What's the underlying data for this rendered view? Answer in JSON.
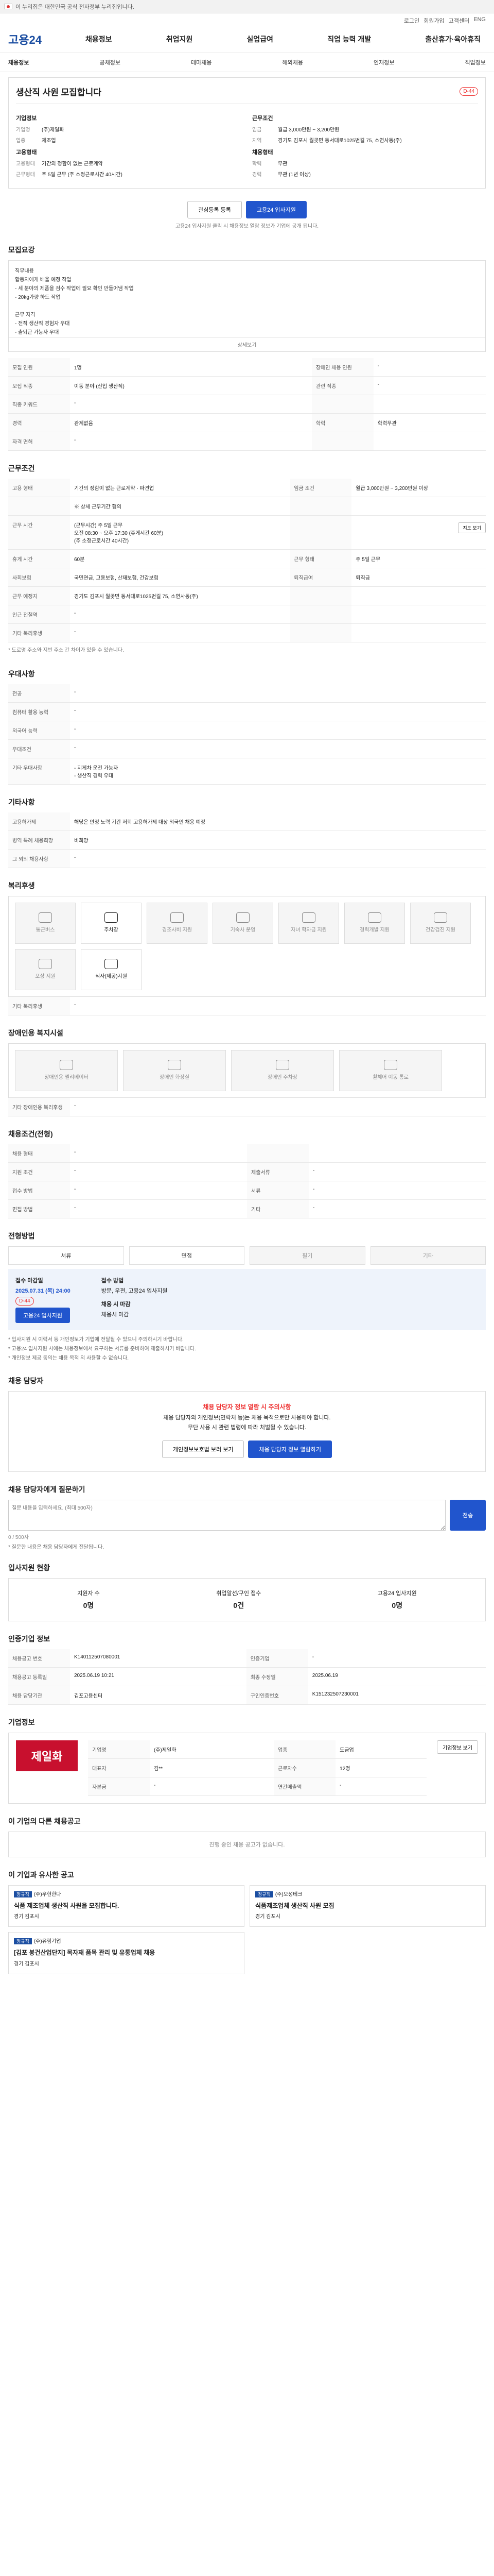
{
  "topbar": {
    "text": "이 누리집은 대한민국 공식 전자정부 누리집입니다."
  },
  "util": [
    "로그인",
    "회원가입",
    "고객센터",
    "ENG"
  ],
  "header": {
    "logo": "고용24",
    "gnb": [
      "채용정보",
      "취업지원",
      "실업급여",
      "직업 능력 개발",
      "출산휴가·육아휴직"
    ]
  },
  "subnav": [
    "채용정보",
    "공채정보",
    "테마채용",
    "해외채용",
    "인재정보",
    "직업정보"
  ],
  "job": {
    "title": "생산직 사원 모집합니다",
    "dday": "D-44",
    "company_h": "기업정보",
    "company": [
      [
        "기업명",
        "(주)제일화"
      ],
      [
        "업종",
        "제조업"
      ]
    ],
    "cond_h": "근무조건",
    "cond": [
      [
        "임금",
        "월급 3,000만원 ~ 3,200만원"
      ],
      [
        "지역",
        "경기도 김포시 월곶면 동서대로1025번길 75, 소연사동(주)"
      ]
    ],
    "hire_h": "고용형태",
    "hire": [
      [
        "고용형태",
        "기간의 정함이 없는 근로계약"
      ],
      [
        "근무형태",
        "주 5일 근무 (주 소정근로시간 40시간)"
      ]
    ],
    "edu_h": "채용형태",
    "edu": [
      [
        "학력",
        "무관"
      ],
      [
        "경력",
        "무관 (1년 이상)"
      ]
    ],
    "btn_interest": "관심등록 등록",
    "btn_apply": "고용24 입사지원",
    "note": "고용24 입사지원 클릭 시 채용정보 열람 정보가 기업에 공개 됩니다."
  },
  "recruit": {
    "h": "모집요강",
    "desc": "직무내용\n합동자에게 배울 예정 작업\n- 세 분야의 제품을 검수 작업에 필요 확인 만들어냄 작업\n- 20kg가량 하드 작업\n\n근무 자격\n- 전직 생산직 경험자 우대\n- 출퇴근 가능자 우대\n- 성실한 분\n- 장기 근속 가능자\n- 신입 및 경력 모두 지원 가능",
    "more": "상세보기",
    "rows": [
      [
        "모집 인원",
        "1명",
        "장애인 채용 인원",
        "-"
      ],
      [
        "모집 직종",
        "이동 분야 (신입 생산직)",
        "관련 직종",
        "-"
      ],
      [
        "직종 키워드",
        "-",
        "",
        ""
      ],
      [
        "경력",
        "관계없음",
        "학력",
        "학력무관"
      ],
      [
        "자격 면허",
        "-",
        "",
        ""
      ]
    ]
  },
  "work": {
    "h": "근무조건",
    "rows": [
      [
        "고용 형태",
        "기간의 정함이 없는 근로계약 · 파견업",
        "임금 조건",
        "월급 3,000만원 ~ 3,200만원 이상"
      ],
      [
        "",
        "※ 상세 근무기간 협의",
        "",
        ""
      ],
      [
        "근무 시간",
        "(근무시간) 주 5일 근무\n오전 08:30 ~ 오후 17:30 (휴게시간 60분)\n(주 소정근로시간 40시간)",
        "",
        ""
      ],
      [
        "휴게 시간",
        "60분",
        "근무 형태",
        "주 5일 근무"
      ],
      [
        "사회보험",
        "국민연금, 고용보험, 산재보험, 건강보험",
        "퇴직급여",
        "퇴직금"
      ],
      [
        "근무 예정지",
        "경기도 김포시 월곶면 동서대로1025번길 75, 소연사동(주)",
        "",
        ""
      ],
      [
        "인근 전철역",
        "-",
        "",
        ""
      ],
      [
        "기타 복리후생",
        "-",
        "",
        ""
      ]
    ],
    "map_btn": "지도 보기",
    "foot": "* 도로명 주소와 지번 주소 간 차이가 있을 수 있습니다."
  },
  "pref": {
    "h": "우대사항",
    "rows": [
      [
        "전공",
        "-"
      ],
      [
        "컴퓨터 활용 능력",
        "-"
      ],
      [
        "외국어 능력",
        "-"
      ],
      [
        "우대조건",
        "-"
      ],
      [
        "기타 우대사항",
        "- 지게차 운전 가능자\n- 생산직 경력 우대"
      ]
    ]
  },
  "etc": {
    "h": "기타사항",
    "rows": [
      [
        "고용허가제",
        "해당은 안정 노력 기간 저희 고용허가제 대상 외국인 채용 예정"
      ],
      [
        "병역 특례 채용희망",
        "비희망"
      ],
      [
        "그 외의 채용사항",
        "-"
      ]
    ]
  },
  "welfare": {
    "h": "복리후생",
    "items": [
      {
        "label": "통근버스",
        "on": false
      },
      {
        "label": "주차장",
        "on": true
      },
      {
        "label": "경조사비 지원",
        "on": false
      },
      {
        "label": "기숙사 운영",
        "on": false
      },
      {
        "label": "자녀 학자금 지원",
        "on": false
      },
      {
        "label": "경력개발 지원",
        "on": false
      },
      {
        "label": "건강검진 지원",
        "on": false
      },
      {
        "label": "포상 지원",
        "on": false
      },
      {
        "label": "식사(제공)지원",
        "on": true
      }
    ],
    "other_label": "기타 복리후생",
    "other_value": "-"
  },
  "disab": {
    "h": "장애인용 복지시설",
    "items": [
      "장애인용 엘리베이터",
      "장애인 화장실",
      "장애인 주차장",
      "휠체어 이동 통로"
    ],
    "other_label": "기타 장애인용 복리후생",
    "other_value": "-"
  },
  "req": {
    "h": "채용조건(전형)",
    "rows": [
      [
        "채용 형태",
        "-",
        "",
        ""
      ],
      [
        "지원 조건",
        "-",
        "제출서류",
        "-"
      ],
      [
        "접수 방법",
        "-",
        "서류",
        "-"
      ],
      [
        "면접 방법",
        "-",
        "기타",
        "-"
      ]
    ]
  },
  "proc": {
    "h": "전형방법",
    "steps": [
      [
        "서류",
        false
      ],
      [
        "면접",
        false
      ],
      [
        "필기",
        true
      ],
      [
        "기타",
        true
      ]
    ]
  },
  "apply": {
    "h1": "접수 마감일",
    "d1": "2025.07.31 (목) 24:00",
    "dday": "D-44",
    "btn": "고용24 입사지원",
    "h2": "접수 방법",
    "d2": "방문, 우편, 고용24 입사지원",
    "h3": "채용 시 마감",
    "d3": "채용시 마감"
  },
  "caution": [
    "* 입사지원 시 이력서 등 개인정보가 기업에 전달될 수 있으니 주의하시기 바랍니다.",
    "* 고용24 입사지원 시에는 채용정보에서 요구하는 서류를 준비하여 제출하시기 바랍니다.",
    "* 개인정보 제공 동의는 채용 목적 외 사용할 수 없습니다."
  ],
  "contact": {
    "h": "채용 담당자",
    "warn_t": "채용 담당자 정보 열람 시 주의사항",
    "warn_1": "채용 담당자의 개인정보(연락처 등)는 채용 목적으로만 사용해야 합니다.",
    "warn_2": "무단 사용 시 관련 법령에 따라 처벌될 수 있습니다.",
    "btn1": "개인정보보호법 보러 보기",
    "btn2": "채용 담당자 정보 열람하기"
  },
  "qna": {
    "h": "채용 담당자에게 질문하기",
    "placeholder": "질문 내용을 입력하세요. (최대 500자)",
    "count": "0 / 500자",
    "btn": "전송",
    "note": "* 질문한 내용은 채용 담당자에게 전달됩니다."
  },
  "stats": {
    "h": "입사지원 현황",
    "items": [
      [
        "지원자 수",
        "0명"
      ],
      [
        "취업알선/구인 접수",
        "0건"
      ],
      [
        "고용24 입사지원",
        "0명"
      ]
    ],
    "more": "더보기"
  },
  "info": {
    "h": "인증기업 정보",
    "rows": [
      [
        "채용공고 번호",
        "K140112507080001",
        "인증기업",
        "-"
      ],
      [
        "채용공고 등록일",
        "2025.06.19 10:21",
        "최종 수정일",
        "2025.06.19"
      ],
      [
        "채용 담당기관",
        "김포고용센터",
        "구인인증번호",
        "K151232507230001"
      ]
    ]
  },
  "company": {
    "h": "기업정보",
    "logo": "제일화",
    "rows": [
      [
        "기업명",
        "(주)제일화",
        "업종",
        "도금업"
      ],
      [
        "대표자",
        "김**",
        "근로자수",
        "12명"
      ],
      [
        "자본금",
        "-",
        "연간매출액",
        "-"
      ]
    ],
    "btn": "기업정보 보기"
  },
  "related": {
    "h": "이 기업의 다른 채용공고",
    "empty": "진행 중인 채용 공고가 없습니다."
  },
  "recommend": {
    "h": "이 기업과 유사한 공고",
    "items": [
      {
        "tag": "정규직",
        "co": "(주)우현한다",
        "t": "식품 제조업체 생산직 사원을 모집합니다.",
        "loc": "경기 김포시"
      },
      {
        "tag": "정규직",
        "co": "(주)오성테크",
        "t": "식품제조업체 생산직 사원 모집",
        "loc": "경기 김포시"
      },
      {
        "tag": "정규직",
        "co": "(주)유림기업",
        "t": "[김포 봉건산업단지] 목자재 품목 관리 및 유통업체 채용",
        "loc": "경기 김포시"
      }
    ]
  }
}
